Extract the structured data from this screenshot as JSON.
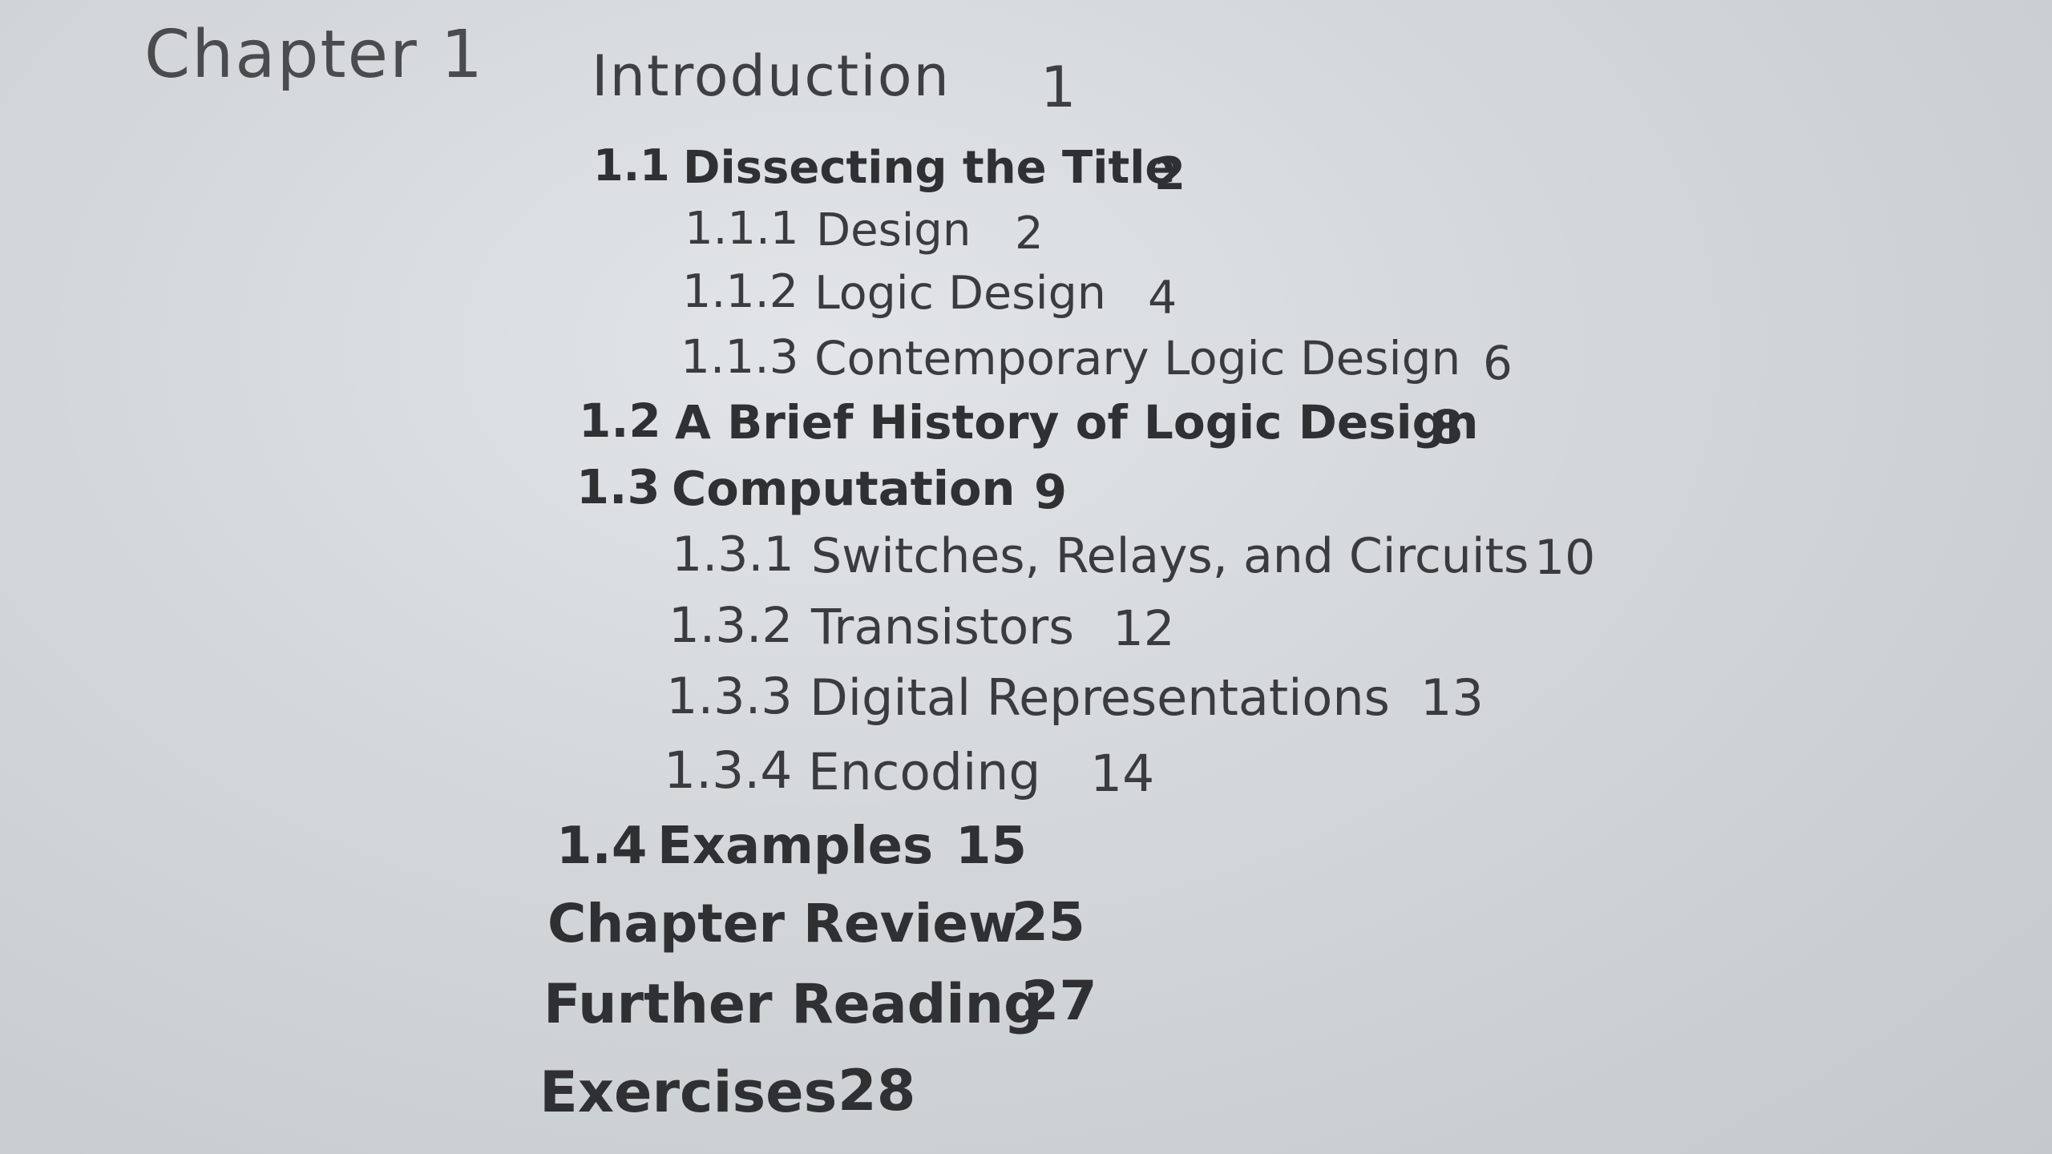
{
  "chapter": {
    "label": "Chapter 1",
    "title": "Introduction",
    "page": "1"
  },
  "entries": [
    {
      "num": "1.1",
      "title": "Dissecting the Title",
      "page": "2"
    },
    {
      "num": "1.1.1",
      "title": "Design",
      "page": "2"
    },
    {
      "num": "1.1.2",
      "title": "Logic Design",
      "page": "4"
    },
    {
      "num": "1.1.3",
      "title": "Contemporary Logic Design",
      "page": "6"
    },
    {
      "num": "1.2",
      "title": "A Brief History of Logic Design",
      "page": "8"
    },
    {
      "num": "1.3",
      "title": "Computation",
      "page": "9"
    },
    {
      "num": "1.3.1",
      "title": "Switches, Relays, and Circuits",
      "page": "10"
    },
    {
      "num": "1.3.2",
      "title": "Transistors",
      "page": "12"
    },
    {
      "num": "1.3.3",
      "title": "Digital Representations",
      "page": "13"
    },
    {
      "num": "1.3.4",
      "title": "Encoding",
      "page": "14"
    },
    {
      "num": "1.4",
      "title": "Examples",
      "page": "15"
    },
    {
      "num": "",
      "title": "Chapter Review",
      "page": "25"
    },
    {
      "num": "",
      "title": "Further Reading",
      "page": "27"
    },
    {
      "num": "",
      "title": "Exercises",
      "page": "28"
    }
  ]
}
